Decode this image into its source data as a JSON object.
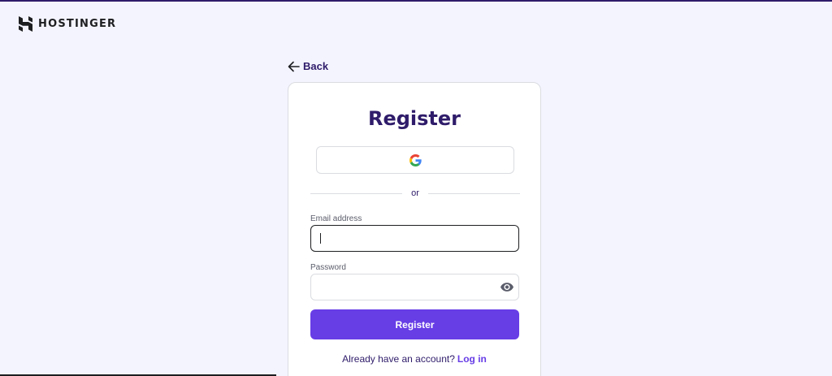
{
  "brand": {
    "name": "HOSTINGER",
    "icon": "hostinger-logo"
  },
  "nav": {
    "back_label": "Back",
    "back_icon": "arrow-left-icon"
  },
  "form": {
    "title": "Register",
    "google_icon": "google-icon",
    "divider_text": "or",
    "email": {
      "label": "Email address",
      "value": "",
      "placeholder": ""
    },
    "password": {
      "label": "Password",
      "value": "",
      "placeholder": "",
      "toggle_icon": "eye-icon"
    },
    "submit_label": "Register",
    "login_prompt": "Already have an account?",
    "login_link": "Log in"
  },
  "colors": {
    "background": "#f4f4ff",
    "primary": "#673de6",
    "heading": "#2f1c6a",
    "border": "#dadce0"
  }
}
